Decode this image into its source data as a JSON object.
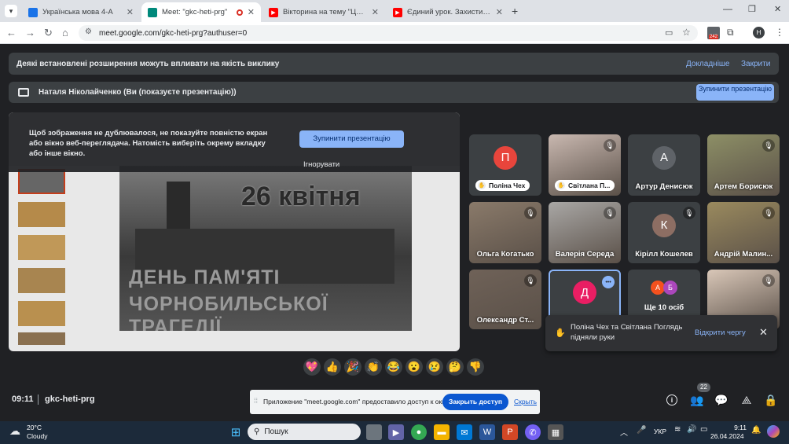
{
  "tabs": [
    {
      "title": "Українська мова 4-А",
      "fav": "#1a73e8",
      "active": false
    },
    {
      "title": "Meet: \"gkc-heti-prg\"",
      "fav": "#00897b",
      "active": true
    },
    {
      "title": "Вікторина на тему \"Цивільний захист\"",
      "fav": "#ff0000",
      "active": false
    },
    {
      "title": "Єдиний урок. Захисти своє життя",
      "fav": "#ff0000",
      "active": false
    }
  ],
  "address": "meet.google.com/gkc-heti-prg?authuser=0",
  "extensions_badge": "242",
  "profile_initial": "H",
  "banner": {
    "text": "Деякі встановлені розширення можуть впливати на якість виклику",
    "more": "Докладніше",
    "close": "Закрити"
  },
  "presenting": {
    "text": "Наталя Ніколайченко (Ви (показуєте презентацію))",
    "stop": "Зупинити презентацію"
  },
  "overlay": {
    "text": "Щоб зображення не дублювалося, не показуйте повністю екран або вікно веб-переглядача. Натомість виберіть окрему вкладку або інше вікно.",
    "stop": "Зупинити презентацію",
    "ignore": "Ігнорувати"
  },
  "slide": {
    "title": "26 квітня",
    "line1": "ДЕНЬ ПАМ'ЯТІ",
    "line2": "ЧОРНОБИЛЬСЬКОЇ ТРАГЕДІЇ"
  },
  "participants": [
    {
      "name": "Поліна Чех",
      "initial": "П",
      "color": "#e8453c",
      "hand": true
    },
    {
      "name": "Світлана П...",
      "initial": "",
      "color": "",
      "hand": true,
      "video": "#c9b8b0"
    },
    {
      "name": "Артур Денисюк",
      "initial": "А",
      "color": "#5f6368",
      "hand": false
    },
    {
      "name": "Артем Борисюк",
      "initial": "",
      "color": "",
      "hand": false,
      "video": "#8d8f66"
    },
    {
      "name": "Ольга Когатько",
      "initial": "",
      "color": "",
      "hand": false,
      "video": "#8a7a6a"
    },
    {
      "name": "Валерія Середа",
      "initial": "",
      "color": "",
      "hand": false,
      "video": "#a9a7a5"
    },
    {
      "name": "Кірілл Кошелев",
      "initial": "К",
      "color": "#8d6e63",
      "hand": false
    },
    {
      "name": "Андрій Малин...",
      "initial": "",
      "color": "",
      "hand": false,
      "video": "#9a8a5e"
    },
    {
      "name": "Олександр Ст...",
      "initial": "",
      "color": "",
      "hand": false,
      "video": "#6f6258"
    },
    {
      "name": "",
      "initial": "Д",
      "color": "#e91e63",
      "hand": false
    },
    {
      "name": "Ще 10 осіб",
      "initial": "",
      "color": "",
      "hand": false
    },
    {
      "name": "",
      "initial": "",
      "color": "",
      "hand": false,
      "video": "#d9c7b8"
    }
  ],
  "more_avatars": [
    "А",
    "Б"
  ],
  "hands_notice": {
    "text": "Поліна Чех та Світлана Поглядь підняли руки",
    "action": "Відкрити чергу"
  },
  "time": "09:11",
  "meeting_code": "gkc-heti-prg",
  "participant_count": "22",
  "share_bar": {
    "text": "Приложение \"meet.google.com\" предоставило доступ к окну.",
    "close": "Закрыть доступ",
    "hide": "Скрыть"
  },
  "emojis": [
    "💖",
    "👍",
    "🎉",
    "👏",
    "😂",
    "😮",
    "😢",
    "🤔",
    "👎"
  ],
  "weather": {
    "temp": "20°C",
    "desc": "Cloudy"
  },
  "search": "Пошук",
  "lang": "УКР",
  "clock": {
    "time": "9:11",
    "date": "26.04.2024"
  },
  "notif_badge": "1"
}
